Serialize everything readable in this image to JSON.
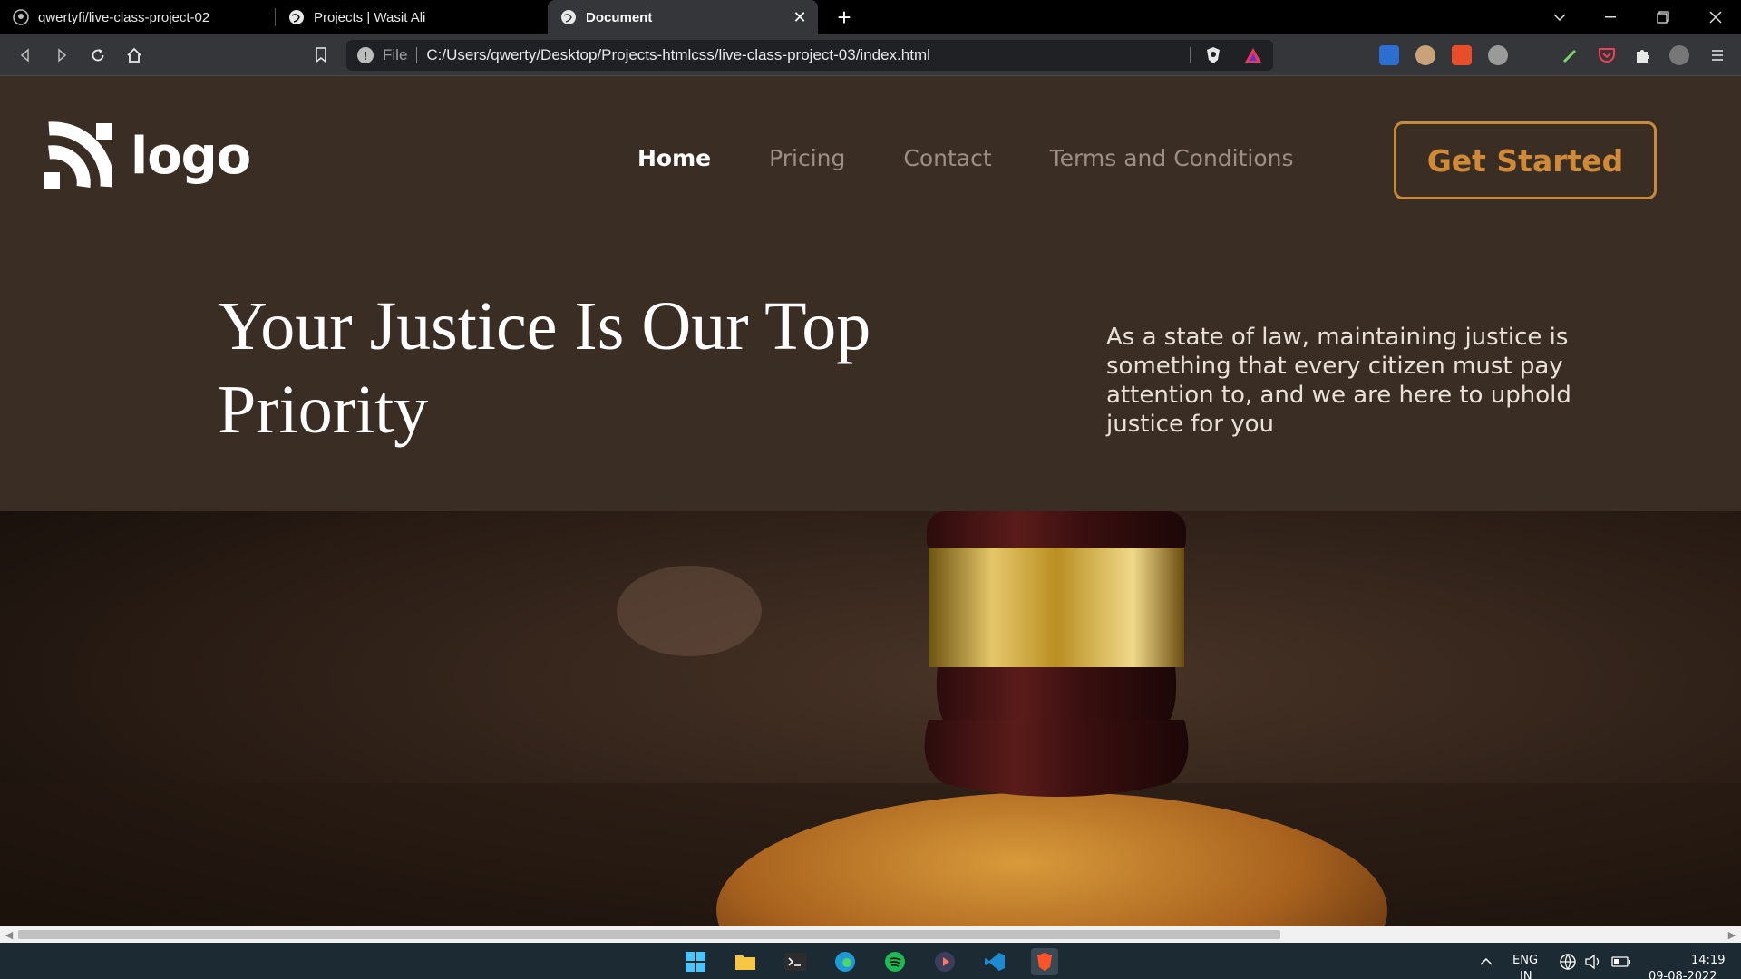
{
  "browser": {
    "tabs": [
      {
        "title": "qwertyfi/live-class-project-02"
      },
      {
        "title": "Projects | Wasit Ali"
      },
      {
        "title": "Document"
      }
    ],
    "address": {
      "scheme": "File",
      "url": "C:/Users/qwerty/Desktop/Projects-htmlcss/live-class-project-03/index.html"
    }
  },
  "site": {
    "logo_text": "logo",
    "nav": [
      {
        "label": "Home",
        "active": true
      },
      {
        "label": "Pricing",
        "active": false
      },
      {
        "label": "Contact",
        "active": false
      },
      {
        "label": "Terms and Conditions",
        "active": false
      }
    ],
    "cta_label": "Get Started",
    "hero": {
      "title": "Your Justice Is Our Top Priority",
      "description": "As a state of law, maintaining justice is something that every citizen must pay attention to, and we are here to uphold justice for you"
    },
    "colors": {
      "background": "#3a2e24",
      "accent": "#c9893b",
      "nav_inactive": "#9c8f82"
    }
  },
  "taskbar": {
    "language": "ENG",
    "region": "IN",
    "time": "14:19",
    "date": "09-08-2022",
    "icons": [
      "windows-start-icon",
      "file-explorer-icon",
      "terminal-icon",
      "edge-icon",
      "spotify-icon",
      "media-player-icon",
      "vscode-icon",
      "brave-browser-icon"
    ]
  }
}
